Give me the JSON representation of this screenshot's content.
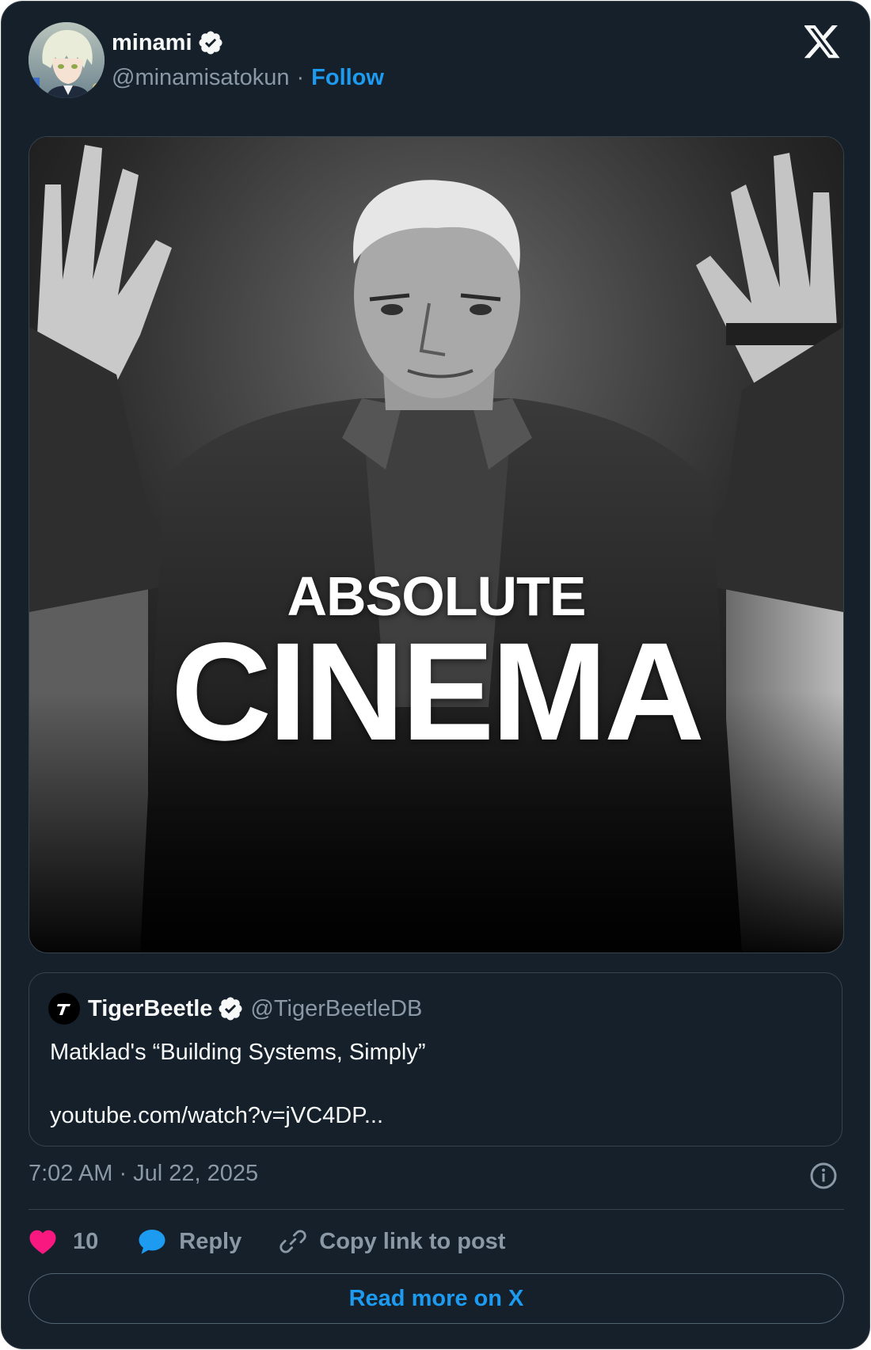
{
  "author": {
    "display_name": "minami",
    "handle": "@minamisatokun",
    "separator": "·",
    "follow_label": "Follow",
    "avatar_icon": "anime-character-avatar",
    "verified_icon": "verified-badge-icon"
  },
  "header": {
    "logo_icon": "x-logo-icon"
  },
  "media": {
    "line1": "ABSOLUTE",
    "line2": "CINEMA"
  },
  "quoted_post": {
    "display_name": "TigerBeetle",
    "handle": "@TigerBeetleDB",
    "text": "Matklad's “Building Systems, Simply”",
    "link": "youtube.com/watch?v=jVC4DP..."
  },
  "timestamp": "7:02 AM · Jul 22, 2025",
  "actions": {
    "like_count": "10",
    "reply_label": "Reply",
    "copy_label": "Copy link to post"
  },
  "read_more_label": "Read more on X",
  "colors": {
    "background": "#15202b",
    "border": "#38444d",
    "accent": "#1d9bf0",
    "like": "#f91880",
    "muted_text": "#8b98a5",
    "primary_text": "#f7f9f9"
  }
}
